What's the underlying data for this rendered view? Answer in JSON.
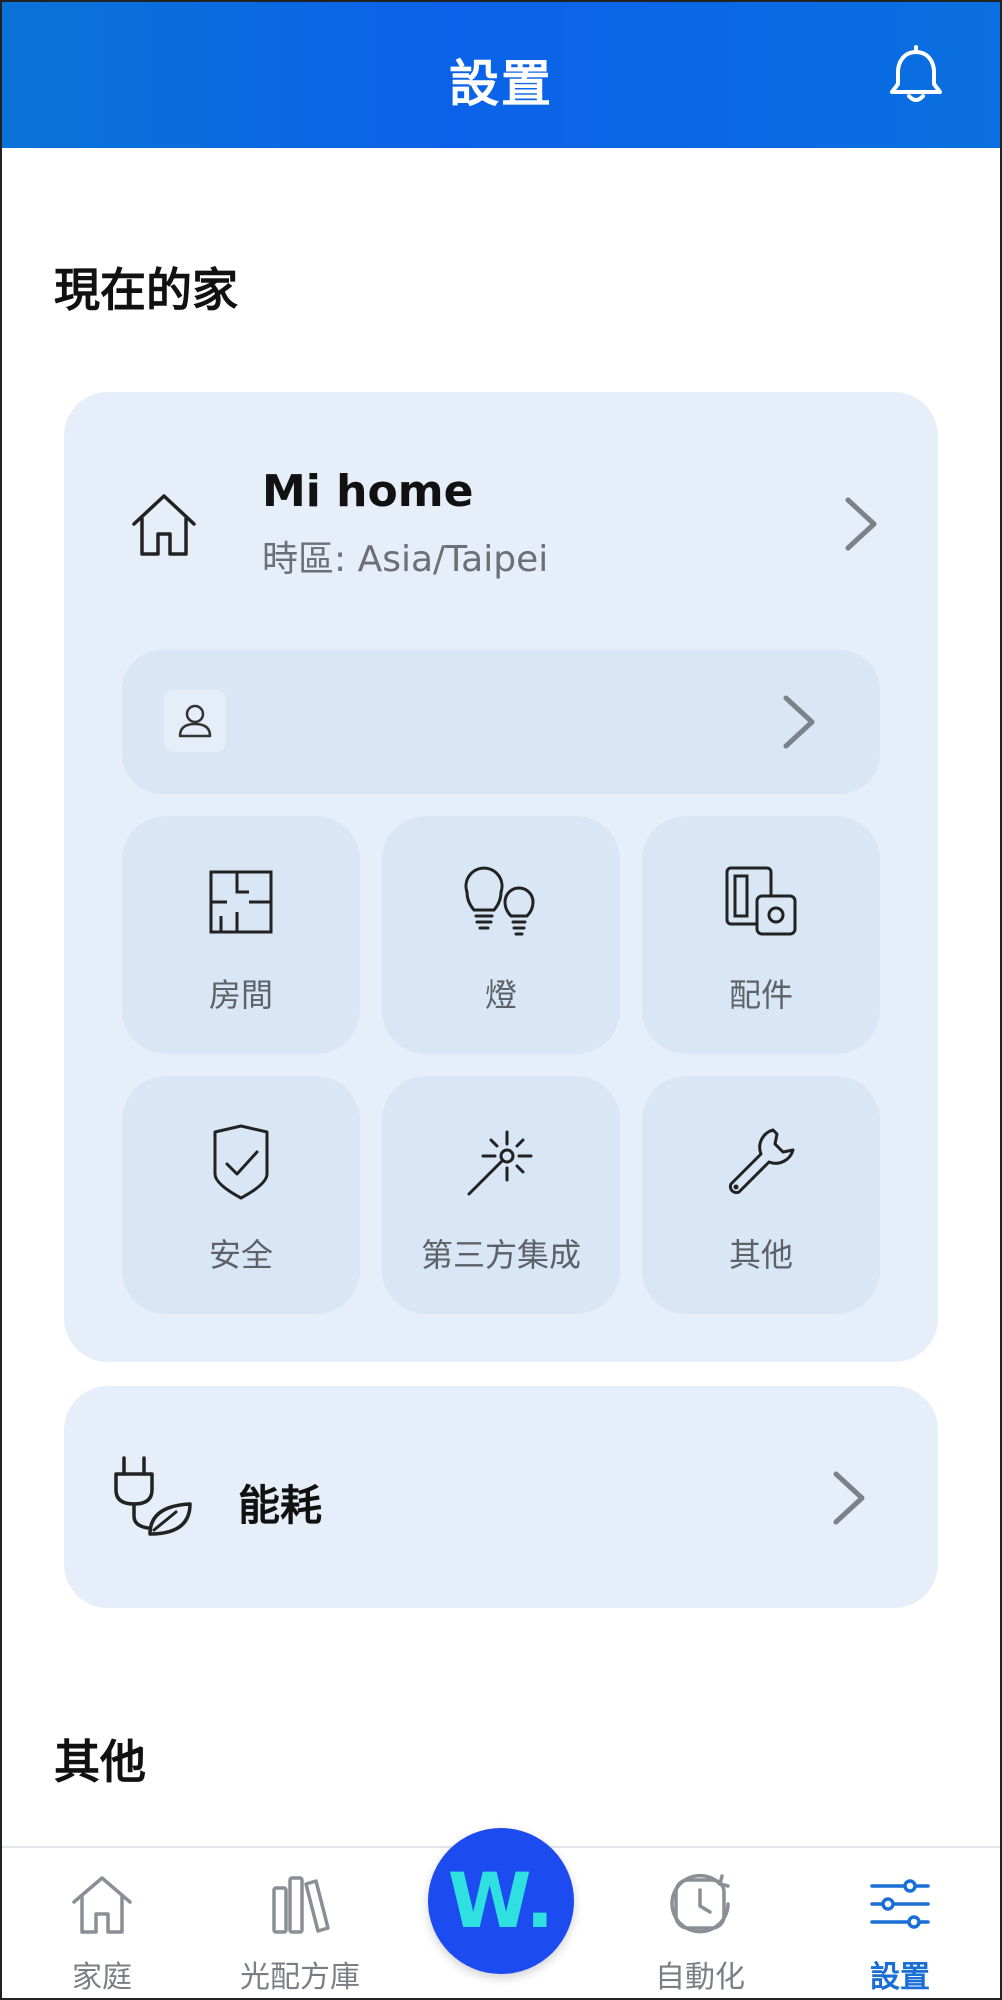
{
  "header": {
    "title": "設置",
    "bell_icon": "bell-icon"
  },
  "current_home_section": {
    "title": "現在的家"
  },
  "home": {
    "name": "Mi home",
    "timezone": "時區: Asia/Taipei",
    "icon": "house-icon"
  },
  "member_row": {
    "icon": "user-icon"
  },
  "tiles": [
    {
      "label": "房間",
      "icon": "floorplan-icon"
    },
    {
      "label": "燈",
      "icon": "bulbs-icon"
    },
    {
      "label": "配件",
      "icon": "switch-icon"
    },
    {
      "label": "安全",
      "icon": "shield-check-icon"
    },
    {
      "label": "第三方集成",
      "icon": "magic-wand-icon"
    },
    {
      "label": "其他",
      "icon": "wrench-icon"
    }
  ],
  "energy": {
    "label": "能耗",
    "icon": "eco-plug-icon"
  },
  "other_section": {
    "title": "其他"
  },
  "nav": {
    "items": [
      {
        "label": "家庭",
        "icon": "house-icon"
      },
      {
        "label": "光配方庫",
        "icon": "library-icon"
      },
      {
        "label": "自動化",
        "icon": "clock-refresh-icon"
      },
      {
        "label": "設置",
        "icon": "sliders-icon"
      }
    ],
    "center_button": {
      "letter": "W.",
      "icon": "brand-logo-icon"
    },
    "active": "設置"
  },
  "colors": {
    "header_gradient_start": "#0a73d8",
    "header_gradient_end": "#0b62e8",
    "card_bg": "#e6eef9",
    "tile_bg": "#d8e6f5",
    "accent_active": "#1a6fd6",
    "fab_bg": "#1c4bf0",
    "fab_letter": "#2ee0e0"
  }
}
